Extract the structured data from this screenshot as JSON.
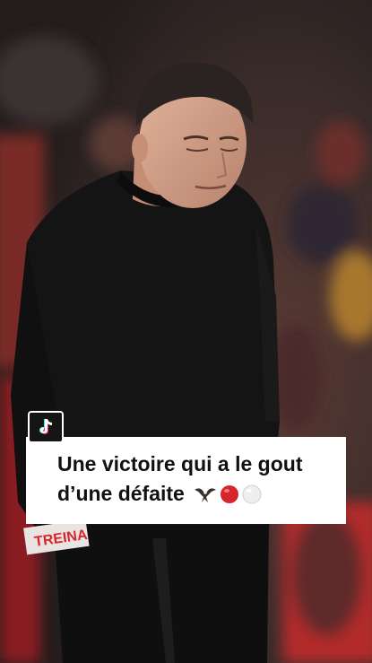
{
  "caption": {
    "line1": "Une victoire qui a le gout",
    "line2": "d’une défaite"
  },
  "emojis": [
    "eagle-icon",
    "red-circle-icon",
    "white-circle-icon"
  ],
  "jersey_text": "TREINA",
  "colors": {
    "card_bg": "#ffffff",
    "caption_text": "#111111",
    "benfica_red": "#d7262b",
    "badge_bg": "#151515"
  }
}
